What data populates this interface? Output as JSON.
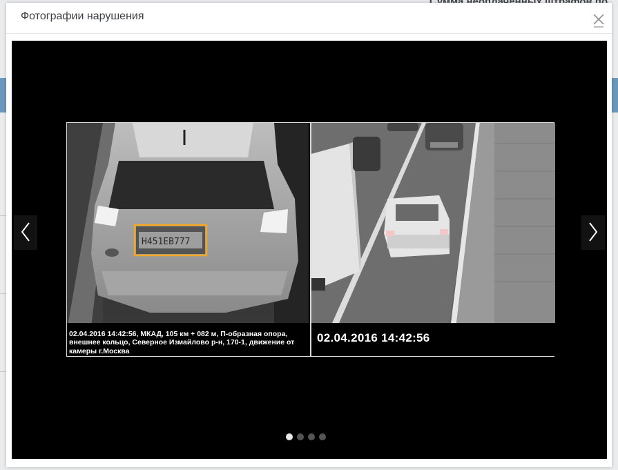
{
  "background": {
    "top_text": "Сумма неоплаченных штрафов по"
  },
  "modal": {
    "title": "Фотографии нарушения",
    "close_icon": "close-icon"
  },
  "carousel": {
    "left_caption": "02.04.2016 14:42:56, МКАД, 105 км + 082 м, П-образная опора, внешнее кольцо, Северное Измайлово р-н, 170-1, движение от камеры г.Москва",
    "plate": "Н451ЕВ777",
    "right_caption": "02.04.2016 14:42:56",
    "prev_icon": "chevron-left-icon",
    "next_icon": "chevron-right-icon",
    "slide_count": 4,
    "active_slide": 1
  }
}
